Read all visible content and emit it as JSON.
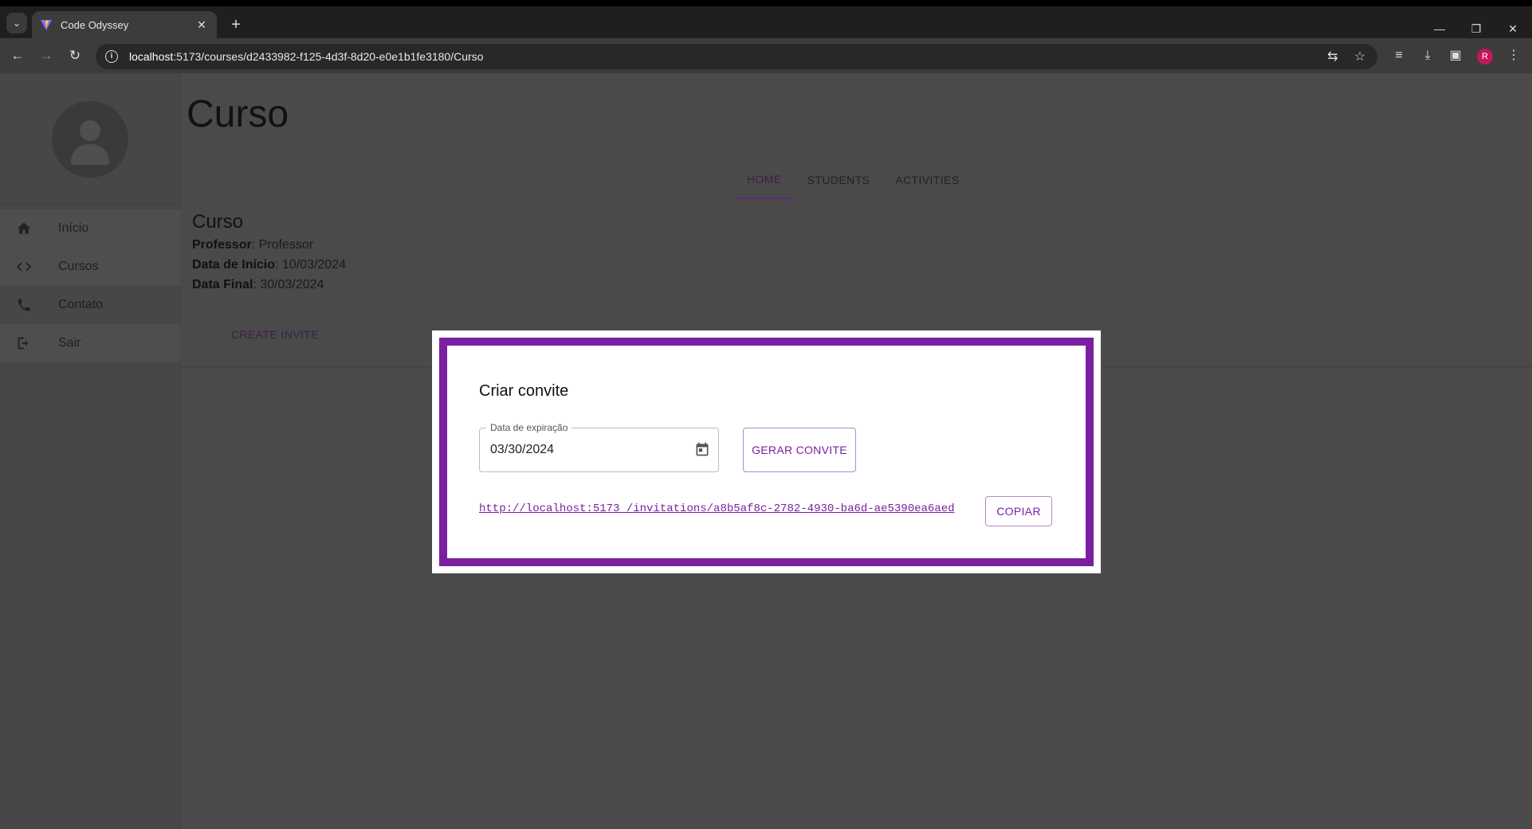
{
  "browser": {
    "tab_title": "Code Odyssey",
    "url_host": "localhost",
    "url_rest": ":5173/courses/d2433982-f125-4d3f-8d20-e0e1b1fe3180/Curso",
    "profile_initial": "R"
  },
  "sidebar": {
    "items": [
      {
        "label": "Início",
        "icon": "home-icon"
      },
      {
        "label": "Cursos",
        "icon": "code-icon"
      },
      {
        "label": "Contato",
        "icon": "phone-icon"
      },
      {
        "label": "Sair",
        "icon": "logout-icon"
      }
    ]
  },
  "main": {
    "page_title": "Curso",
    "tabs": [
      {
        "label": "HOME",
        "active": true
      },
      {
        "label": "STUDENTS",
        "active": false
      },
      {
        "label": "ACTIVITIES",
        "active": false
      }
    ],
    "course": {
      "name": "Curso",
      "professor_label": "Professor",
      "professor_value": ": Professor",
      "start_label": "Data de Início",
      "start_value": ": 10/03/2024",
      "end_label": "Data Final",
      "end_value": ": 30/03/2024"
    },
    "create_invite_label": "CREATE INVITE"
  },
  "modal": {
    "title": "Criar convite",
    "date_label": "Data de expiração",
    "date_value": "03/30/2024",
    "generate_label": "GERAR CONVITE",
    "invite_link": "http://localhost:5173_/invitations/a8b5af8c-2782-4930-ba6d-ae5390ea6aed",
    "copy_label": "COPIAR",
    "accent_color": "#7b1fa2"
  }
}
